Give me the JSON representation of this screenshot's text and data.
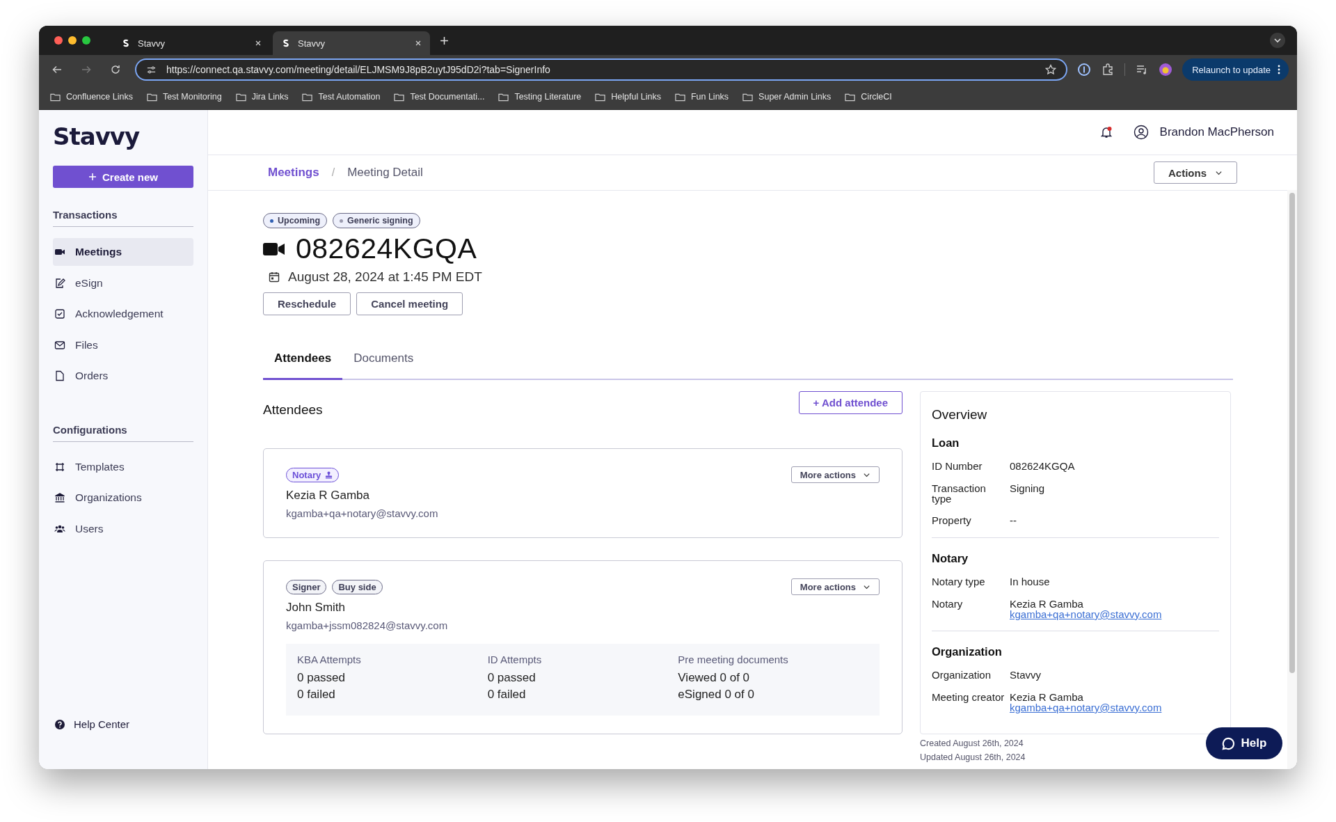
{
  "browser": {
    "tabs": [
      {
        "title": "Stavvy",
        "selected": false
      },
      {
        "title": "Stavvy",
        "selected": true
      }
    ],
    "url": "https://connect.qa.stavvy.com/meeting/detail/ELJMSM9J8pB2uytJ95dD2i?tab=SignerInfo",
    "relaunch_label": "Relaunch to update",
    "bookmarks": [
      "Confluence Links",
      "Test Monitoring",
      "Jira Links",
      "Test Automation",
      "Test Documentati...",
      "Testing Literature",
      "Helpful Links",
      "Fun Links",
      "Super Admin Links",
      "CircleCI"
    ]
  },
  "sidebar": {
    "logo": "Stavvy",
    "create_button": "Create new",
    "sections": [
      {
        "title": "Transactions",
        "items": [
          {
            "label": "Meetings",
            "selected": true
          },
          {
            "label": "eSign",
            "selected": false
          },
          {
            "label": "Acknowledgement",
            "selected": false
          },
          {
            "label": "Files",
            "selected": false
          },
          {
            "label": "Orders",
            "selected": false
          }
        ]
      },
      {
        "title": "Configurations",
        "items": [
          {
            "label": "Templates",
            "selected": false
          },
          {
            "label": "Organizations",
            "selected": false
          },
          {
            "label": "Users",
            "selected": false
          }
        ]
      }
    ],
    "help_center": "Help Center"
  },
  "header": {
    "user_name": "Brandon MacPherson"
  },
  "breadcrumbs": [
    "Meetings",
    "Meeting Detail"
  ],
  "breadcrumb_separator": "/",
  "actions_button": "Actions",
  "meeting": {
    "badges": [
      {
        "label": "Upcoming",
        "color": "#2f5fb3"
      },
      {
        "label": "Generic signing",
        "color": "#9a9aae"
      }
    ],
    "id": "082624KGQA",
    "datetime": "August 28, 2024 at 1:45 PM EDT",
    "buttons": [
      "Reschedule",
      "Cancel meeting"
    ]
  },
  "tabs": [
    {
      "label": "Attendees",
      "selected": true
    },
    {
      "label": "Documents",
      "selected": false
    }
  ],
  "attendees": {
    "title": "Attendees",
    "add_button": "+ Add attendee",
    "items": [
      {
        "tags": [
          {
            "label": "Notary",
            "kind": "notary"
          }
        ],
        "name": "Kezia R Gamba",
        "email": "kgamba+qa+notary@stavvy.com",
        "more_actions": "More actions"
      },
      {
        "tags": [
          {
            "label": "Signer",
            "kind": "plain"
          },
          {
            "label": "Buy side",
            "kind": "plain"
          }
        ],
        "name": "John Smith",
        "email": "kgamba+jssm082824@stavvy.com",
        "more_actions": "More actions",
        "stats": [
          {
            "title": "KBA Attempts",
            "lines": [
              "0 passed",
              "0 failed"
            ]
          },
          {
            "title": "ID Attempts",
            "lines": [
              "0 passed",
              "0 failed"
            ]
          },
          {
            "title": "Pre meeting documents",
            "lines": [
              "Viewed 0 of 0",
              "eSigned 0 of 0"
            ]
          }
        ]
      }
    ]
  },
  "overview": {
    "title": "Overview",
    "sections": [
      {
        "title": "Loan",
        "rows": [
          {
            "label": "ID Number",
            "value": "082624KGQA"
          },
          {
            "label": "Transaction type",
            "value": "Signing"
          },
          {
            "label": "Property",
            "value": "--"
          }
        ]
      },
      {
        "title": "Notary",
        "rows": [
          {
            "label": "Notary type",
            "value": "In house"
          },
          {
            "label": "Notary",
            "value": "Kezia R Gamba",
            "email": "kgamba+qa+notary@stavvy.com"
          }
        ]
      },
      {
        "title": "Organization",
        "rows": [
          {
            "label": "Organization",
            "value": "Stavvy"
          },
          {
            "label": "Meeting creator",
            "value": "Kezia R Gamba",
            "email": "kgamba+qa+notary@stavvy.com"
          }
        ]
      }
    ],
    "created": "Created August 26th, 2024",
    "updated": "Updated August 26th, 2024"
  },
  "help_button": "Help"
}
